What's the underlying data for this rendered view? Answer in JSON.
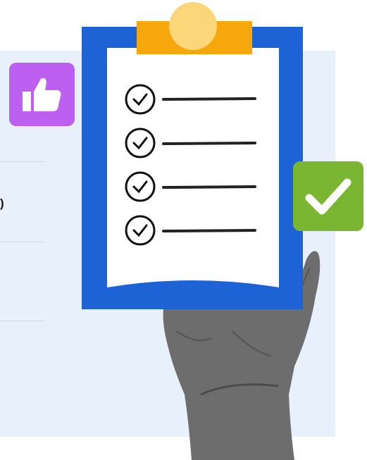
{
  "colors": {
    "panel_bg": "#e8f0fb",
    "clipboard_blue": "#1e63d6",
    "clip_orange": "#f5a70b",
    "clip_circle": "#fbd77a",
    "paper": "#ffffff",
    "thumbs_badge": "#bd5ff0",
    "check_badge": "#7ab631",
    "skin": "#6d6d6d"
  },
  "partial_text": ")",
  "checklist": [
    {
      "icon": "check-circle-icon"
    },
    {
      "icon": "check-circle-icon"
    },
    {
      "icon": "check-circle-icon"
    },
    {
      "icon": "check-circle-icon"
    }
  ],
  "icons": {
    "thumbs": "thumbs-up-icon",
    "check": "checkmark-icon",
    "clipboard": "clipboard-icon",
    "hand": "hand-illustration"
  }
}
